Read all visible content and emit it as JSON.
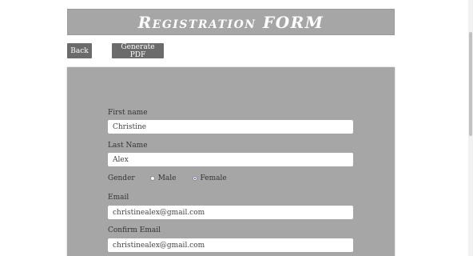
{
  "header": {
    "title": "Registration FORM"
  },
  "toolbar": {
    "back_label": "Back",
    "pdf_label": "Generate PDF"
  },
  "form": {
    "first_name": {
      "label": "First name",
      "value": "Christine"
    },
    "last_name": {
      "label": "Last Name",
      "value": "Alex"
    },
    "gender": {
      "label": "Gender",
      "options": [
        {
          "label": "Male",
          "checked": false
        },
        {
          "label": "Female",
          "checked": true
        }
      ]
    },
    "email": {
      "label": "Email",
      "value": "christinealex@gmail.com"
    },
    "confirm_email": {
      "label": "Confirm Email",
      "value": "christinealex@gmail.com"
    }
  },
  "colors": {
    "panel": "#a6a6a6",
    "button": "#6b6b6b",
    "radio_selected": "#3a52b8"
  }
}
